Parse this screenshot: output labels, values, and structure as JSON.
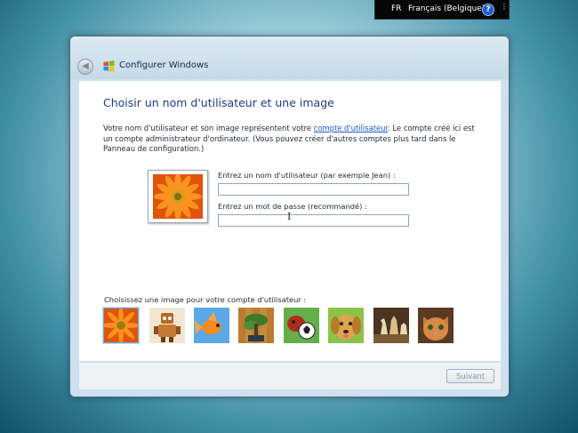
{
  "language_bar": {
    "code": "FR",
    "language": "Français (Belgique)",
    "help_symbol": "?",
    "menu_symbol": "⋮"
  },
  "window": {
    "title": "Configurer Windows",
    "back_symbol": "◀"
  },
  "page": {
    "heading": "Choisir un nom d'utilisateur et une image",
    "description_before_link": "Votre nom d'utilisateur et son image représentent votre ",
    "description_link": "compte d'utilisateur",
    "description_after_link": ". Le compte créé ici est un compte administrateur d'ordinateur. (Vous pouvez créer d'autres comptes plus tard dans le Panneau de configuration.)",
    "username_label": "Entrez un nom d'utilisateur (par exemple Jean) :",
    "username_value": "",
    "password_label": "Entrez un mot de passe (recommandé) :",
    "password_value": "",
    "picture_chooser_label": "Choisissez une image pour votre compte d'utilisateur :"
  },
  "pictures": [
    {
      "name": "flower",
      "selected": true
    },
    {
      "name": "robot",
      "selected": false
    },
    {
      "name": "goldfish",
      "selected": false
    },
    {
      "name": "bonsai",
      "selected": false
    },
    {
      "name": "soccer-ball-dog",
      "selected": false
    },
    {
      "name": "puppy",
      "selected": false
    },
    {
      "name": "chess",
      "selected": false
    },
    {
      "name": "kitten",
      "selected": false
    }
  ],
  "footer": {
    "next_label": "Suivant"
  },
  "colors": {
    "heading": "#1e3a8a",
    "link": "#1b56c8",
    "accent_orange": "#f07a14"
  }
}
